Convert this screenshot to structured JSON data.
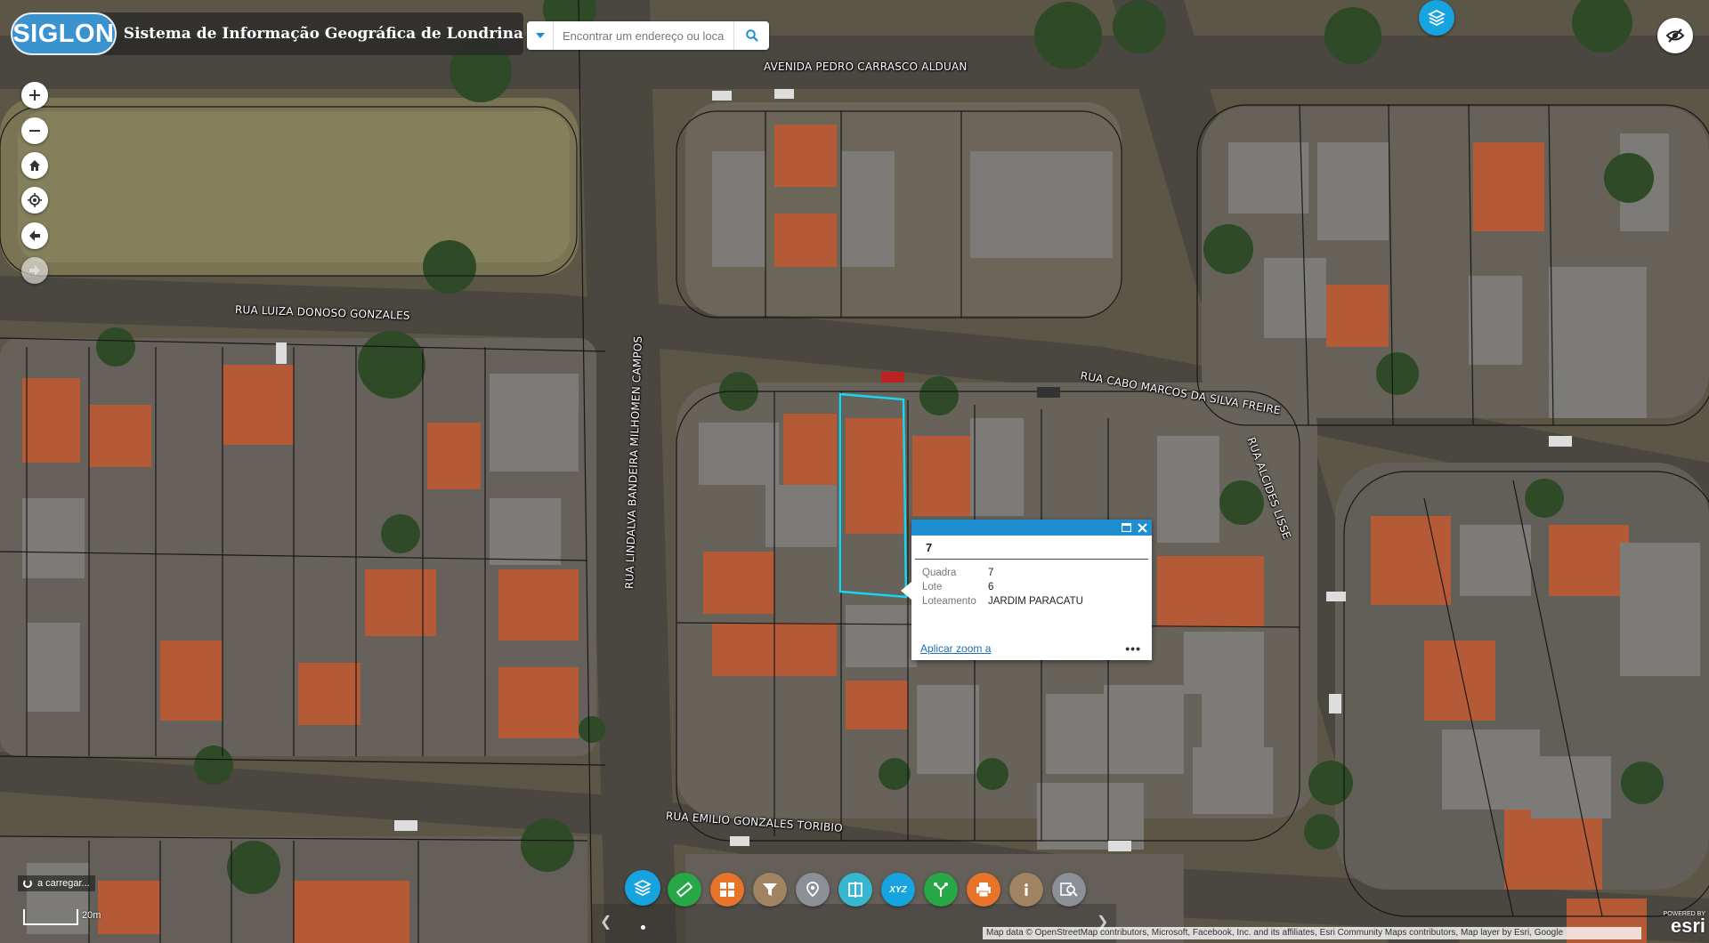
{
  "header": {
    "logo_text": "SIGLON",
    "title": "Sistema de Informação Geográfica de Londrina"
  },
  "search": {
    "placeholder": "Encontrar um endereço ou loca"
  },
  "map_labels": {
    "avenida": "AVENIDA PEDRO CARRASCO ALDUAN",
    "luiza": "RUA LUIZA DONOSO GONZALES",
    "lindalva": "RUA LINDALVA BANDEIRA MILHOMEN CAMPOS",
    "cabo": "RUA CABO MARCOS DA SILVA FREIRE",
    "alcides": "RUA ALCIDES LISSE",
    "emilio": "RUA EMILIO GONZALES TORIBIO"
  },
  "popup": {
    "title": "7",
    "rows": [
      {
        "key": "Quadra",
        "value": "7"
      },
      {
        "key": "Lote",
        "value": "6"
      },
      {
        "key": "Loteamento",
        "value": "JARDIM PARACATU"
      }
    ],
    "zoom_link": "Aplicar zoom a",
    "more": "•••"
  },
  "status": {
    "loading": "a carregar...",
    "scale": "20m"
  },
  "attribution": "Map data © OpenStreetMap contributors, Microsoft, Facebook, Inc. and its affiliates, Esri Community Maps contributors, Map layer by Esri, Google",
  "esri": {
    "powered_by": "POWERED BY",
    "brand": "esri"
  },
  "toolbar": {
    "tools": [
      {
        "name": "layers-tool",
        "icon": "layers-icon",
        "color": "#17a3e0"
      },
      {
        "name": "measure-tool",
        "icon": "ruler-icon",
        "color": "#27a745"
      },
      {
        "name": "basemap-tool",
        "icon": "grid-icon",
        "color": "#e8742a"
      },
      {
        "name": "filter-tool",
        "icon": "filter-icon",
        "color": "#a08461"
      },
      {
        "name": "location-tool",
        "icon": "location-icon",
        "color": "#8b8f96"
      },
      {
        "name": "swipe-tool",
        "icon": "swipe-icon",
        "color": "#38b8d0"
      },
      {
        "name": "coordinate-tool",
        "icon": "xyz-icon",
        "color": "#17a3e0"
      },
      {
        "name": "share-tool",
        "icon": "share-icon",
        "color": "#27a745"
      },
      {
        "name": "print-tool",
        "icon": "printer-icon",
        "color": "#e8742a"
      },
      {
        "name": "about-tool",
        "icon": "info-icon",
        "color": "#a08461"
      },
      {
        "name": "query-tool",
        "icon": "query-icon",
        "color": "#8b8f96"
      }
    ],
    "xyz_label": "XYZ"
  },
  "colors": {
    "accent": "#1e8ed0",
    "parcel_highlight": "#19d6f0",
    "logo_blue": "#3a93cf"
  }
}
